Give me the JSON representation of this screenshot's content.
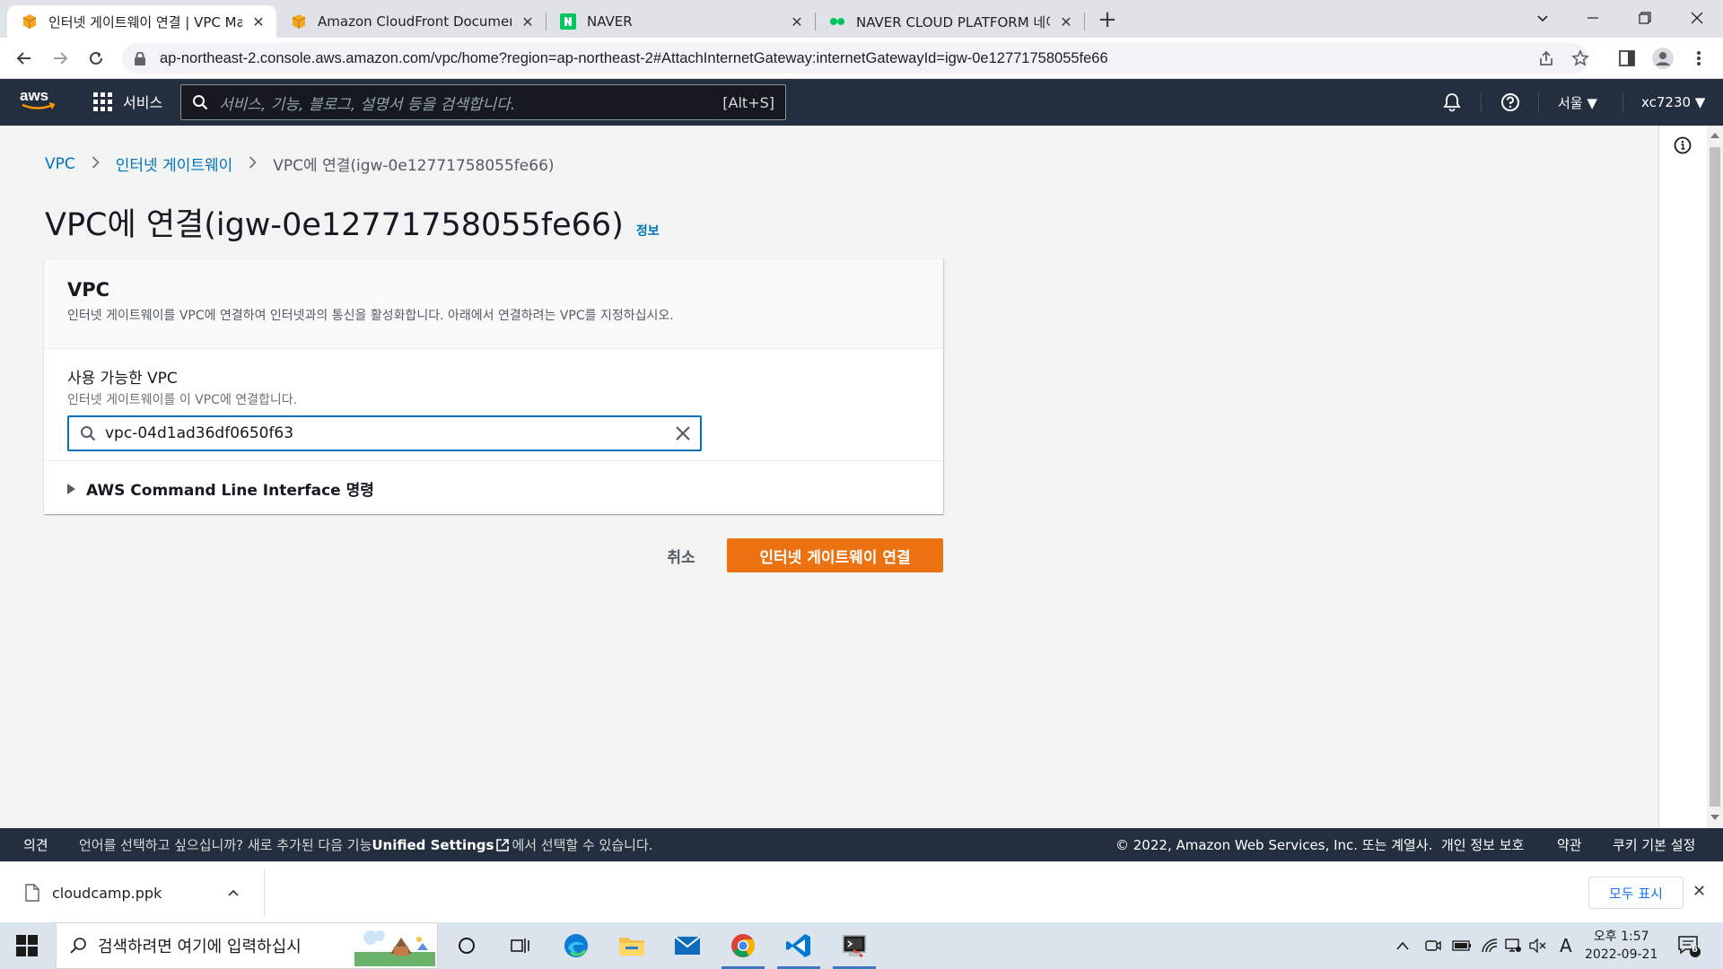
{
  "browser": {
    "tabs": [
      {
        "title": "인터넷 게이트웨이 연결 | VPC Ma",
        "active": true,
        "icon": "aws-box-icon"
      },
      {
        "title": "Amazon CloudFront Documenta",
        "active": false,
        "icon": "aws-box-icon"
      },
      {
        "title": "NAVER",
        "active": false,
        "icon": "naver-icon"
      },
      {
        "title": "NAVER CLOUD PLATFORM 네이",
        "active": false,
        "icon": "ncp-icon"
      }
    ],
    "url": "ap-northeast-2.console.aws.amazon.com/vpc/home?region=ap-northeast-2#AttachInternetGateway:internetGatewayId=igw-0e12771758055fe66"
  },
  "awsnav": {
    "logo": "aws",
    "services_label": "서비스",
    "search_placeholder": "서비스, 기능, 블로그, 설명서 등을 검색합니다.",
    "search_shortcut": "[Alt+S]",
    "region": "서울 ▼",
    "account": "xc7230 ▼"
  },
  "breadcrumb": {
    "items": [
      "VPC",
      "인터넷 게이트웨이"
    ],
    "current": "VPC에 연결(igw-0e12771758055fe66)"
  },
  "page": {
    "title": "VPC에 연결(igw-0e12771758055fe66)",
    "info_link": "정보"
  },
  "panel": {
    "heading": "VPC",
    "description": "인터넷 게이트웨이를 VPC에 연결하여 인터넷과의 통신을 활성화합니다. 아래에서 연결하려는 VPC를 지정하십시오.",
    "field_label": "사용 가능한 VPC",
    "field_description": "인터넷 게이트웨이를 이 VPC에 연결합니다.",
    "field_value": "vpc-04d1ad36df0650f63",
    "cli_label": "AWS Command Line Interface 명령"
  },
  "actions": {
    "cancel": "취소",
    "submit": "인터넷 게이트웨이 연결"
  },
  "footer": {
    "feedback": "의견",
    "language_prefix": "언어를 선택하고 싶으십니까? 새로 추가된 다음 기능",
    "unified_settings": "Unified Settings",
    "language_suffix": "에서 선택할 수 있습니다.",
    "copyright": "© 2022, Amazon Web Services, Inc. 또는 계열사.",
    "privacy": "개인 정보 보호",
    "terms": "약관",
    "cookies": "쿠키 기본 설정"
  },
  "download": {
    "filename": "cloudcamp.ppk",
    "show_all": "모두 표시"
  },
  "taskbar": {
    "search_placeholder": "검색하려면 여기에 입력하십시",
    "time": "오후 1:57",
    "date": "2022-09-21",
    "ime": "A",
    "notification_count": "6"
  },
  "colors": {
    "aws_nav": "#232f3e",
    "primary_button": "#ec7211",
    "link": "#0073bb",
    "input_focus": "#0073bb"
  }
}
